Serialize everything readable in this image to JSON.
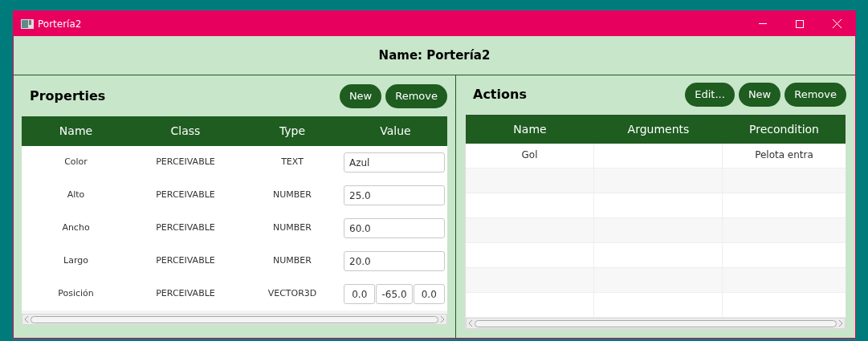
{
  "window": {
    "title": "Portería2"
  },
  "header": {
    "title": "Name: Portería2"
  },
  "properties": {
    "title": "Properties",
    "buttons": [
      "New",
      "Remove"
    ],
    "columns": [
      "Name",
      "Class",
      "Type",
      "Value"
    ],
    "rows": [
      {
        "name": "Color",
        "class": "PERCEIVABLE",
        "type": "TEXT",
        "kind": "single",
        "value": [
          "Azul"
        ]
      },
      {
        "name": "Alto",
        "class": "PERCEIVABLE",
        "type": "NUMBER",
        "kind": "single",
        "value": [
          "25.0"
        ]
      },
      {
        "name": "Ancho",
        "class": "PERCEIVABLE",
        "type": "NUMBER",
        "kind": "single",
        "value": [
          "60.0"
        ]
      },
      {
        "name": "Largo",
        "class": "PERCEIVABLE",
        "type": "NUMBER",
        "kind": "single",
        "value": [
          "20.0"
        ]
      },
      {
        "name": "Posición",
        "class": "PERCEIVABLE",
        "type": "VECTOR3D",
        "kind": "vector",
        "value": [
          "0.0",
          "-65.0",
          "0.0"
        ]
      }
    ]
  },
  "actions": {
    "title": "Actions",
    "buttons": [
      "Edit...",
      "New",
      "Remove"
    ],
    "columns": [
      "Name",
      "Arguments",
      "Precondition"
    ],
    "rows": [
      {
        "name": "Gol",
        "precondition": "Pelota entra"
      }
    ]
  }
}
